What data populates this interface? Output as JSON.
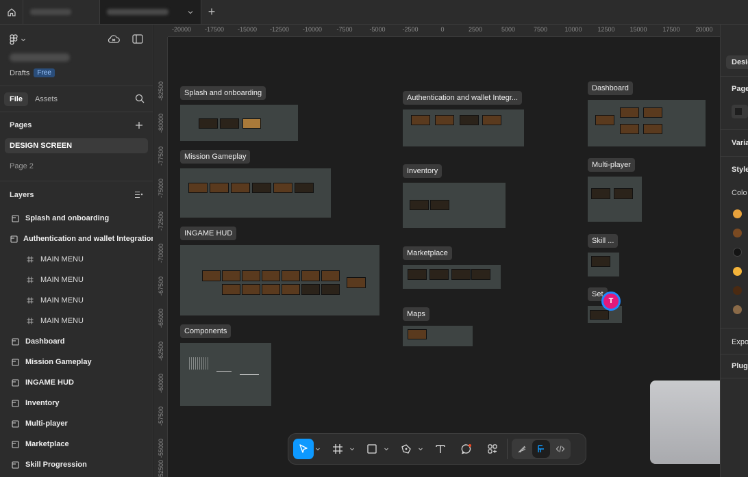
{
  "tabs": {
    "home_icon": "home-icon",
    "add_label": "+"
  },
  "sidebar": {
    "drafts_label": "Drafts",
    "plan_badge": "Free",
    "tab_file": "File",
    "tab_assets": "Assets",
    "pages_title": "Pages",
    "pages": [
      {
        "label": "DESIGN SCREEN",
        "active": true
      },
      {
        "label": "Page 2",
        "active": false
      }
    ],
    "layers_title": "Layers",
    "layers": [
      {
        "label": "Splash and onboarding",
        "type": "section"
      },
      {
        "label": "Authentication and wallet Integration",
        "type": "section"
      },
      {
        "label": "MAIN MENU",
        "type": "frame"
      },
      {
        "label": "MAIN MENU",
        "type": "frame"
      },
      {
        "label": "MAIN MENU",
        "type": "frame"
      },
      {
        "label": "MAIN MENU",
        "type": "frame"
      },
      {
        "label": "Dashboard",
        "type": "section"
      },
      {
        "label": "Mission Gameplay",
        "type": "section"
      },
      {
        "label": "INGAME HUD",
        "type": "section"
      },
      {
        "label": "Inventory",
        "type": "section"
      },
      {
        "label": "Multi-player",
        "type": "section"
      },
      {
        "label": "Marketplace",
        "type": "section"
      },
      {
        "label": "Skill Progression",
        "type": "section"
      }
    ]
  },
  "ruler": {
    "top": [
      "-20000",
      "-17500",
      "-15000",
      "-12500",
      "-10000",
      "-7500",
      "-5000",
      "-2500",
      "0",
      "2500",
      "5000",
      "7500",
      "10000",
      "12500",
      "15000",
      "17500",
      "20000"
    ],
    "left": [
      "-82500",
      "-80000",
      "-77500",
      "-75000",
      "-72500",
      "-70000",
      "-67500",
      "-65000",
      "-62500",
      "-60000",
      "-57500",
      "-55000",
      "-52500"
    ]
  },
  "canvas": {
    "frames": [
      {
        "label": "Splash and onboarding"
      },
      {
        "label": "Mission Gameplay"
      },
      {
        "label": "INGAME HUD"
      },
      {
        "label": "Components"
      },
      {
        "label": "Authentication and wallet Integr..."
      },
      {
        "label": "Inventory"
      },
      {
        "label": "Marketplace"
      },
      {
        "label": "Maps"
      },
      {
        "label": "Dashboard"
      },
      {
        "label": "Multi-player"
      },
      {
        "label": "Skill ..."
      },
      {
        "label": "Set"
      }
    ],
    "collaborator_initial": "T"
  },
  "toolbar": {
    "tools": [
      "move-tool",
      "frame-tool",
      "shape-tool",
      "pen-tool",
      "text-tool",
      "comment-tool",
      "actions-tool"
    ],
    "modes": [
      "draw-mode",
      "design-mode",
      "dev-mode"
    ]
  },
  "right_panel": {
    "tab": "Desig",
    "pages_label": "Page",
    "variables_label": "Varia",
    "styles_label": "Style",
    "colors_label": "Colo",
    "swatches": [
      "#e8a23c",
      "#7a4a22",
      "#141414",
      "#f4b43a",
      "#4a2a12",
      "#8a6a48"
    ],
    "export_label": "Expo",
    "plugins_label": "Plugi"
  },
  "colors": {
    "accent": "#0d99ff",
    "canvas": "#1e1e1e",
    "panel": "#2c2c2c",
    "section_fill": "#3e4443",
    "collaborator": "#e3197b"
  }
}
